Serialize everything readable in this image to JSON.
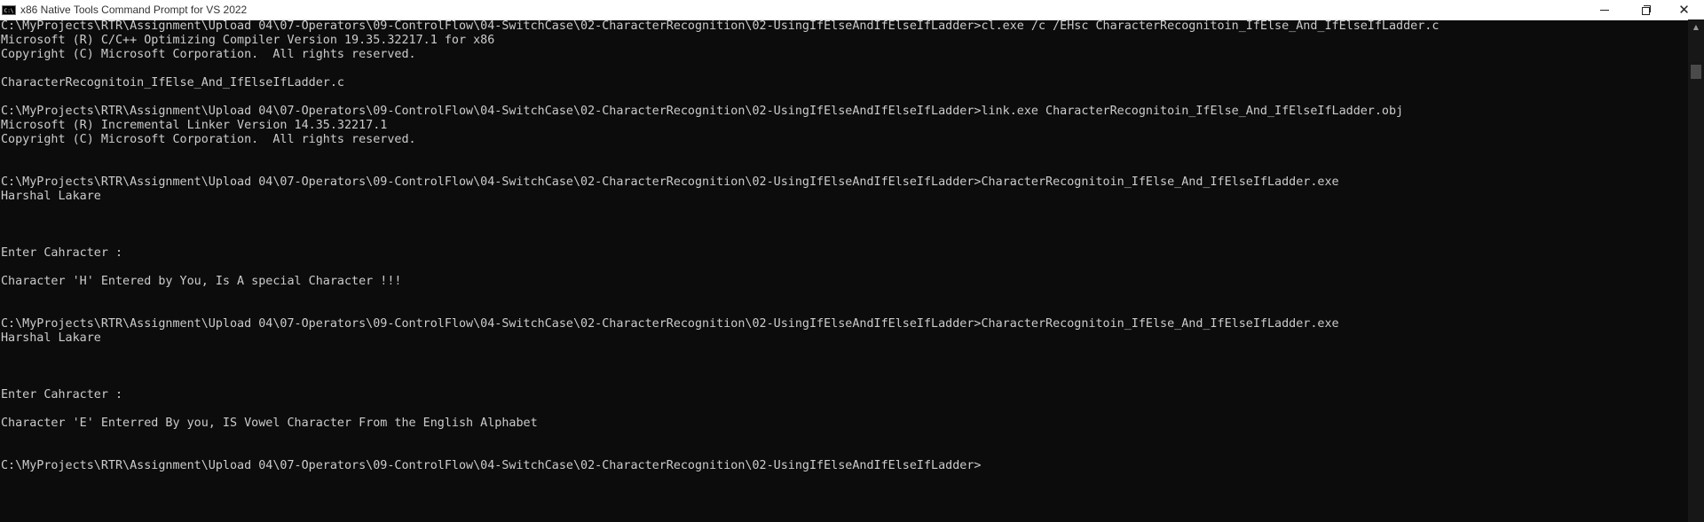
{
  "window": {
    "title": "x86 Native Tools Command Prompt for VS 2022",
    "icon_text": "C:\\",
    "controls": {
      "minimize": "minimize",
      "maximize": "restore",
      "close": "✕"
    }
  },
  "console": {
    "lines": [
      "C:\\MyProjects\\RTR\\Assignment\\Upload 04\\07-Operators\\09-ControlFlow\\04-SwitchCase\\02-CharacterRecognition\\02-UsingIfElseAndIfElseIfLadder>cl.exe /c /EHsc CharacterRecognitoin_IfElse_And_IfElseIfLadder.c",
      "Microsoft (R) C/C++ Optimizing Compiler Version 19.35.32217.1 for x86",
      "Copyright (C) Microsoft Corporation.  All rights reserved.",
      "",
      "CharacterRecognitoin_IfElse_And_IfElseIfLadder.c",
      "",
      "C:\\MyProjects\\RTR\\Assignment\\Upload 04\\07-Operators\\09-ControlFlow\\04-SwitchCase\\02-CharacterRecognition\\02-UsingIfElseAndIfElseIfLadder>link.exe CharacterRecognitoin_IfElse_And_IfElseIfLadder.obj",
      "Microsoft (R) Incremental Linker Version 14.35.32217.1",
      "Copyright (C) Microsoft Corporation.  All rights reserved.",
      "",
      "",
      "C:\\MyProjects\\RTR\\Assignment\\Upload 04\\07-Operators\\09-ControlFlow\\04-SwitchCase\\02-CharacterRecognition\\02-UsingIfElseAndIfElseIfLadder>CharacterRecognitoin_IfElse_And_IfElseIfLadder.exe",
      "Harshal Lakare",
      "",
      "",
      "",
      "Enter Cahracter :",
      "",
      "Character 'H' Entered by You, Is A special Character !!!",
      "",
      "",
      "C:\\MyProjects\\RTR\\Assignment\\Upload 04\\07-Operators\\09-ControlFlow\\04-SwitchCase\\02-CharacterRecognition\\02-UsingIfElseAndIfElseIfLadder>CharacterRecognitoin_IfElse_And_IfElseIfLadder.exe",
      "Harshal Lakare",
      "",
      "",
      "",
      "Enter Cahracter :",
      "",
      "Character 'E' Enterred By you, IS Vowel Character From the English Alphabet",
      "",
      "",
      "C:\\MyProjects\\RTR\\Assignment\\Upload 04\\07-Operators\\09-ControlFlow\\04-SwitchCase\\02-CharacterRecognition\\02-UsingIfElseAndIfElseIfLadder>"
    ]
  },
  "colors": {
    "background": "#0c0c0c",
    "text": "#cccccc",
    "titlebar": "#ffffff"
  },
  "scrollbar": {
    "up_arrow": "▲"
  }
}
